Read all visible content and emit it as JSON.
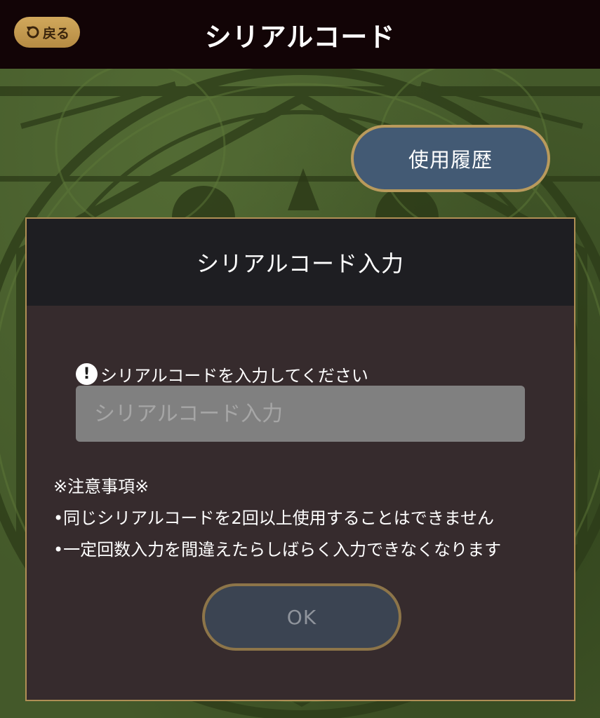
{
  "header": {
    "back_label": "戻る",
    "title": "シリアルコード"
  },
  "history_button": "使用履歴",
  "dialog": {
    "title": "シリアルコード入力",
    "input_label": "シリアルコードを入力してください",
    "input_placeholder": "シリアルコード入力",
    "input_value": "",
    "notes": {
      "heading": "※注意事項※",
      "items": [
        "•同じシリアルコードを2回以上使用することはできません",
        "•一定回数入力を間違えたらしばらく入力できなくなります"
      ]
    },
    "ok_label": "OK"
  },
  "colors": {
    "header_bg": "#120406",
    "back_button": "#c9a055",
    "history_button": "#435a74",
    "dialog_bg": "#362b2d",
    "dialog_border": "#b08f55",
    "ok_button": "#3b4452"
  },
  "icons": {
    "back": "undo-arrow-icon",
    "alert": "exclamation-circle-icon"
  }
}
